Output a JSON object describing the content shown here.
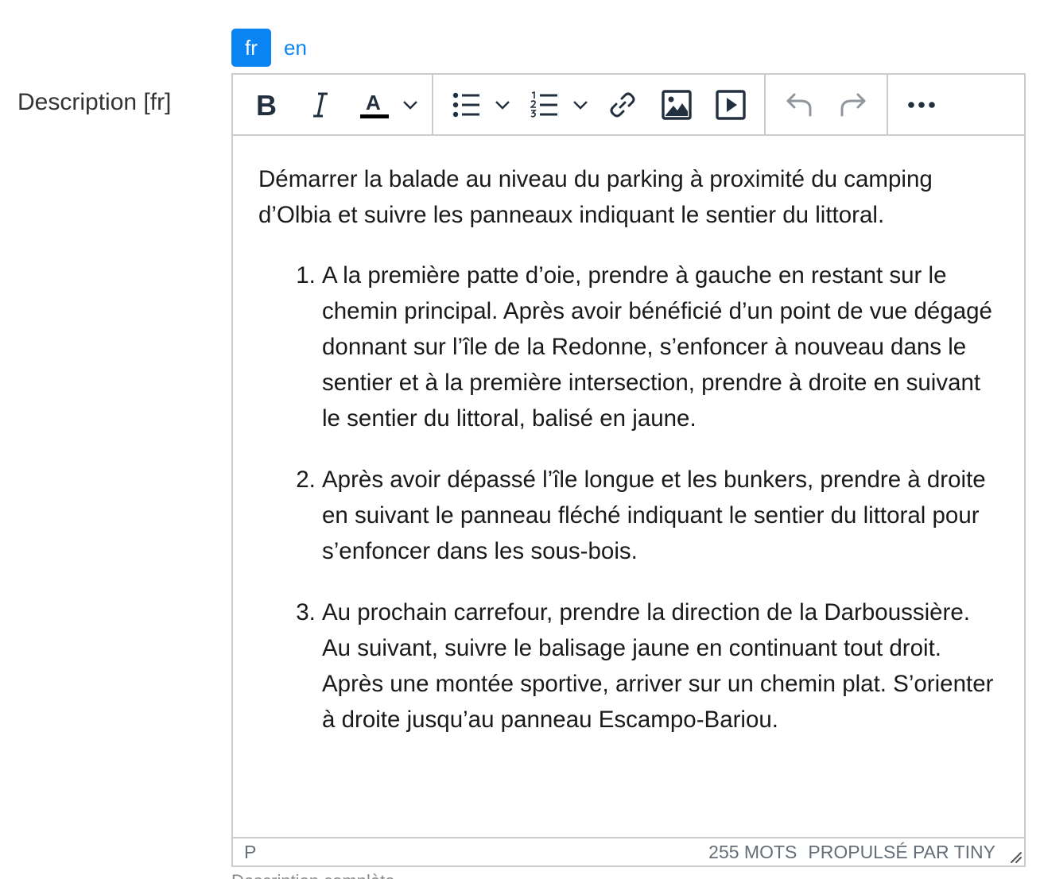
{
  "lang_tabs": [
    {
      "label": "fr",
      "active": true
    },
    {
      "label": "en",
      "active": false
    }
  ],
  "field": {
    "label": "Description [fr]"
  },
  "toolbar": {
    "bold_label": "B",
    "italic_label": "I",
    "text_color_label": "A",
    "icons": [
      "bold-icon",
      "italic-icon",
      "text-color-icon",
      "bullet-list-icon",
      "numbered-list-icon",
      "link-icon",
      "image-icon",
      "media-icon",
      "undo-icon",
      "redo-icon",
      "more-icon"
    ]
  },
  "content": {
    "intro": "Démarrer la balade au niveau du parking à proximité du camping d’Olbia et suivre les panneaux indiquant le sentier du littoral.",
    "steps": [
      "A la première patte d’oie, prendre à gauche en restant sur le chemin principal. Après avoir bénéficié d’un point de vue dégagé donnant sur l’île de la Redonne, s’enfoncer à nouveau dans le sentier et à la première intersection, prendre à droite en suivant le sentier du littoral, balisé en jaune.",
      "Après avoir dépassé l’île longue et les bunkers, prendre à droite en suivant le panneau fléché indiquant le sentier du littoral pour s’enfoncer dans les sous-bois.",
      "Au prochain carrefour, prendre la direction de la Darboussière. Au suivant, suivre le balisage jaune en continuant tout droit. Après une montée sportive, arriver sur un chemin plat. S’orienter à droite jusqu’au panneau Escampo-Bariou."
    ]
  },
  "statusbar": {
    "path": "P",
    "word_count": "255 MOTS",
    "branding": "PROPULSÉ PAR TINY"
  },
  "below": {
    "text": "Description complète"
  },
  "colors": {
    "accent": "#0b84f3",
    "border": "#cccccc",
    "icon": "#222f3e"
  }
}
